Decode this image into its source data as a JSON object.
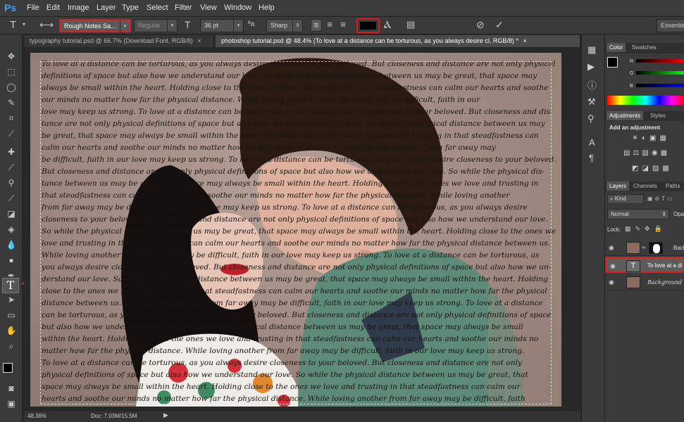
{
  "app": {
    "logo": "Ps"
  },
  "menu": [
    "File",
    "Edit",
    "Image",
    "Layer",
    "Type",
    "Select",
    "Filter",
    "View",
    "Window",
    "Help"
  ],
  "options": {
    "font_family": "Rough Notes Sa...",
    "font_style": "Regular",
    "size": "36 pt",
    "antialias": "Sharp",
    "workspace": "Essentia",
    "text_color": "#000000"
  },
  "tabs": [
    {
      "label": "typography tutorial.psd @ 66.7% (Download Font, RGB/8)",
      "close": "×"
    },
    {
      "label": "photoshop tutorial.psd @ 48.4% (To love at a distance can be torturous, as you always desire cl, RGB/8) *",
      "close": "×"
    }
  ],
  "status": {
    "zoom": "48.36%",
    "doc": "Doc: 7.03M/15.5M"
  },
  "color_panel": {
    "tabs": [
      "Color",
      "Swatches"
    ],
    "channels": [
      "R",
      "G",
      "B"
    ]
  },
  "adjustments_panel": {
    "tabs": [
      "Adjustments",
      "Styles"
    ],
    "heading": "Add an adjustment"
  },
  "layers_panel": {
    "tabs": [
      "Layers",
      "Channels",
      "Paths"
    ],
    "filter": "Kind",
    "blend_mode": "Normal",
    "opacity_label": "Opa",
    "lock_label": "Lock:",
    "layers": [
      {
        "name": "Back",
        "type": "masked"
      },
      {
        "name": "To love at a di",
        "type": "text",
        "selected": true
      },
      {
        "name": "Background",
        "type": "image"
      }
    ]
  },
  "canvas_text": [
    "To love at a distance can be torturous, as you always desire closeness to your beloved. But closeness and distance are not only physical",
    "definitions of space but also how we understand our love. So while the physical distance between us may be great, that space may",
    "always be small within the heart. Holding close to the ones we love and trusting in that steadfastness can calm our hearts and soothe",
    "our minds no matter how far the physical distance. While loving another from far away may be difficult, faith in our",
    "love may keep us strong. To love at a distance can be torturous, as you always desire closeness to your beloved. But closeness and dis-",
    "tance are not only physical definitions of space but also how we understand our love. So while the physical distance between us may",
    "be great, that space may always be small within the heart. Holding close to the ones we love and trusting in that steadfastness can",
    "calm our hearts and soothe our minds no matter how far the physical distance. While loving another from far away may",
    "be difficult, faith in our love may keep us strong. To love at a distance can be torturous, as you always desire closeness to your beloved.",
    "But closeness and distance are not only physical definitions of space but also how we understand our love. So while the physical dis-",
    "tance between us may be great, that space may always be small within the heart. Holding close to the ones we love and trusting in",
    "that steadfastness can calm our hearts and soothe our minds no matter how far the physical distance. While loving another",
    "from far away may be difficult, faith in our love may keep us strong. To love at a distance can be torturous, as you always desire",
    "closeness to your beloved. But closeness and distance are not only physical definitions of space but also how we understand our love.",
    "So while the physical distance between us may be great, that space may always be small within the heart. Holding close to the ones we",
    "love and trusting in that steadfastness can calm our hearts and soothe our minds no matter how far the physical distance between us.",
    "While loving another from far away may be difficult, faith in our love may keep us strong. To love at a distance can be torturous, as",
    "you always desire closeness to your beloved. But closeness and distance are not only physical definitions of space but also how we un-",
    "derstand our love. So while the physical distance between us may be great, that space may always be small within the heart. Holding",
    "close to the ones we love and trusting in that steadfastness can calm our hearts and soothe our minds no matter how far the physical",
    "distance between us. While loving another from far away may be difficult, faith in our love may keep us strong. To love at a distance",
    "can be torturous, as you always desire closeness to your beloved. But closeness and distance are not only physical definitions of space",
    "but also how we understand our love. So while the physical distance between us may be great, that space may always be small",
    "within the heart. Holding close to the ones we love and trusting in that steadfastness can calm our hearts and soothe our minds no",
    "matter how far the physical distance. While loving another from far away may be difficult, faith in our love may keep us strong.",
    "To love at a distance can be torturous, as you always desire closeness to your beloved. But closeness and distance are not only",
    "physical definitions of space but also how we understand our love. So while the physical distance between us may be great, that",
    "space may always be small within the heart. Holding close to the ones we love and trusting in that steadfastness can calm our",
    "hearts and soothe our minds no matter how far the physical distance. While loving another from far away may be difficult, faith"
  ],
  "colors": {
    "highlight": "#e01b1b",
    "ps_blue": "#31a8ff"
  }
}
